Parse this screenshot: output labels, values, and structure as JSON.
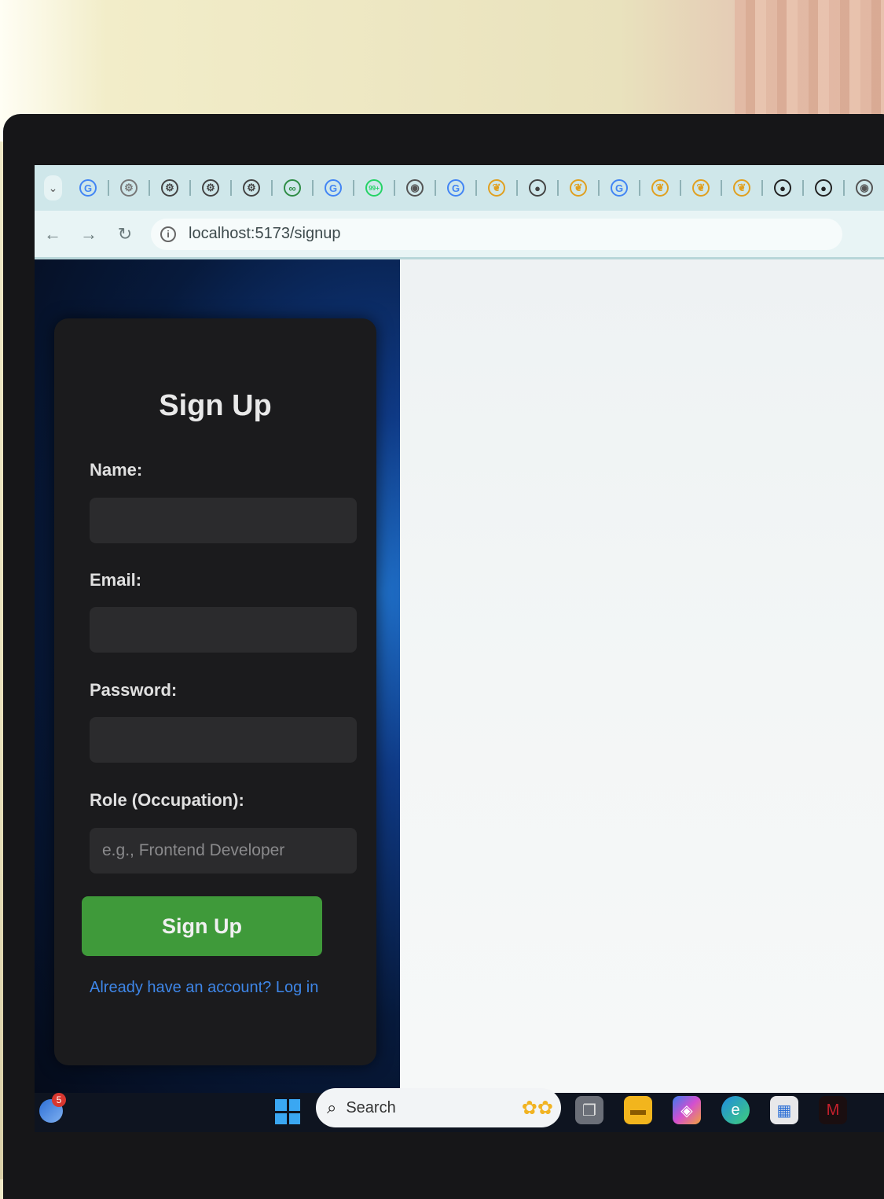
{
  "browser": {
    "url": "localhost:5173/signup",
    "tabs": [
      {
        "icon": "google-icon",
        "glyph": "G",
        "color": "#4285f4"
      },
      {
        "icon": "chatgpt-icon",
        "glyph": "⚙",
        "color": "#777777"
      },
      {
        "icon": "chatgpt-icon",
        "glyph": "⚙",
        "color": "#444444"
      },
      {
        "icon": "chatgpt-icon",
        "glyph": "⚙",
        "color": "#444444"
      },
      {
        "icon": "chatgpt-icon",
        "glyph": "⚙",
        "color": "#444444"
      },
      {
        "icon": "geeksforgeeks-icon",
        "glyph": "∞",
        "color": "#2f8d46"
      },
      {
        "icon": "google-icon",
        "glyph": "G",
        "color": "#4285f4"
      },
      {
        "icon": "whatsapp-icon",
        "glyph": "99+",
        "color": "#25d366"
      },
      {
        "icon": "chrome-icon",
        "glyph": "◉",
        "color": "#555555"
      },
      {
        "icon": "google-icon",
        "glyph": "G",
        "color": "#4285f4"
      },
      {
        "icon": "pin-icon",
        "glyph": "❦",
        "color": "#e0a020"
      },
      {
        "icon": "globe-icon",
        "glyph": "●",
        "color": "#444444"
      },
      {
        "icon": "pin-icon",
        "glyph": "❦",
        "color": "#e0a020"
      },
      {
        "icon": "google-icon",
        "glyph": "G",
        "color": "#4285f4"
      },
      {
        "icon": "pin-icon",
        "glyph": "❦",
        "color": "#e0a020"
      },
      {
        "icon": "pin-icon",
        "glyph": "❦",
        "color": "#e0a020"
      },
      {
        "icon": "pin-icon",
        "glyph": "❦",
        "color": "#e0a020"
      },
      {
        "icon": "mongodb-icon",
        "glyph": "●",
        "color": "#222222"
      },
      {
        "icon": "mongodb-icon",
        "glyph": "●",
        "color": "#222222"
      },
      {
        "icon": "chrome-icon",
        "glyph": "◉",
        "color": "#555555"
      }
    ]
  },
  "form": {
    "title": "Sign Up",
    "name_label": "Name:",
    "email_label": "Email:",
    "password_label": "Password:",
    "role_label": "Role (Occupation):",
    "role_placeholder": "e.g., Frontend Developer",
    "submit_label": "Sign Up",
    "login_link": "Already have an account? Log in"
  },
  "taskbar": {
    "notification_count": "5",
    "search_label": "Search"
  },
  "colors": {
    "button_green": "#3f9a3a",
    "link_blue": "#3e86e8",
    "card_bg": "#1b1b1d"
  }
}
